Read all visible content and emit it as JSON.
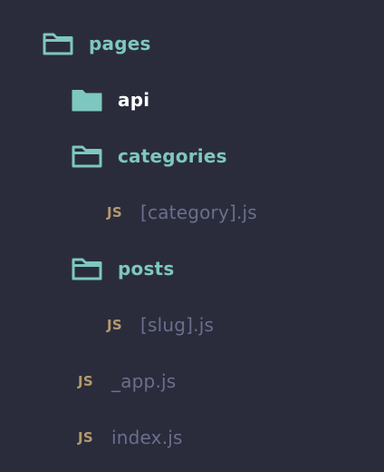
{
  "colors": {
    "background": "#2a2c3c",
    "folder_accent": "#7ec7c0",
    "active_folder_text": "#ffffff",
    "file_text": "#6a6f8c",
    "js_badge": "#b59a6c"
  },
  "tree": {
    "pages": {
      "label": "pages",
      "icon": "folder-outline-icon"
    },
    "api": {
      "label": "api",
      "icon": "folder-filled-icon",
      "selected": true
    },
    "categories": {
      "label": "categories",
      "icon": "folder-outline-icon"
    },
    "category_file": {
      "badge": "JS",
      "label": "[category].js"
    },
    "posts": {
      "label": "posts",
      "icon": "folder-outline-icon"
    },
    "slug_file": {
      "badge": "JS",
      "label": "[slug].js"
    },
    "app_file": {
      "badge": "JS",
      "label": "_app.js"
    },
    "index_file": {
      "badge": "JS",
      "label": "index.js"
    }
  }
}
